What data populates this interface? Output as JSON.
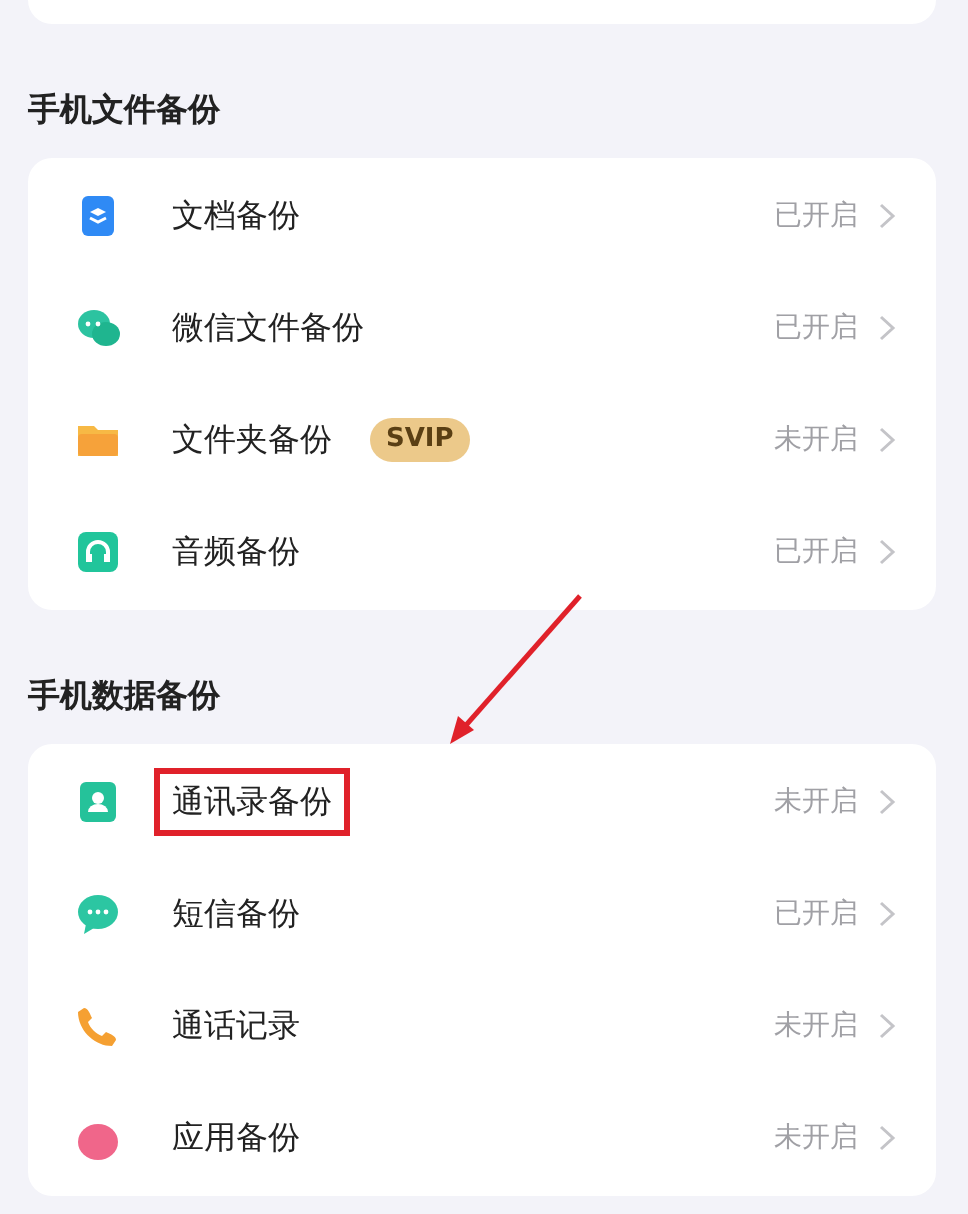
{
  "sections": [
    {
      "title": "手机文件备份",
      "items": [
        {
          "label": "文档备份",
          "status": "已开启",
          "highlighted": false
        },
        {
          "label": "微信文件备份",
          "status": "已开启",
          "highlighted": false
        },
        {
          "label": "文件夹备份",
          "badge": "SVIP",
          "status": "未开启",
          "highlighted": false
        },
        {
          "label": "音频备份",
          "status": "已开启",
          "highlighted": false
        }
      ]
    },
    {
      "title": "手机数据备份",
      "arrow": true,
      "items": [
        {
          "label": "通讯录备份",
          "status": "未开启",
          "highlighted": true
        },
        {
          "label": "短信备份",
          "status": "已开启",
          "highlighted": false
        },
        {
          "label": "通话记录",
          "status": "未开启",
          "highlighted": false
        },
        {
          "label": "应用备份",
          "status": "未开启",
          "highlighted": false
        }
      ]
    }
  ]
}
